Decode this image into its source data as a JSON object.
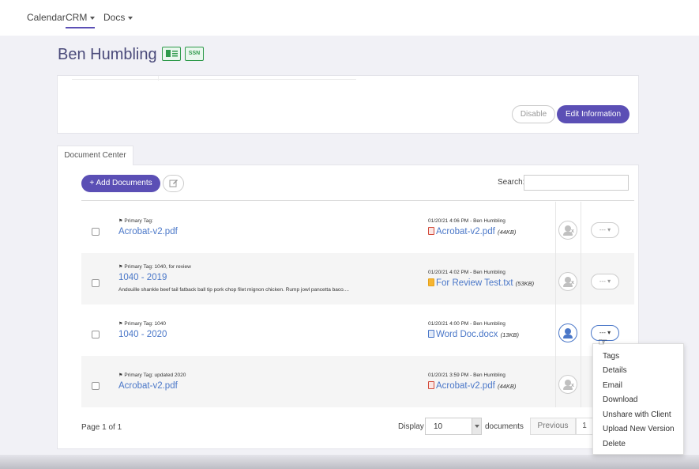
{
  "topnav": {
    "items": [
      {
        "label": "Calendar",
        "has_caret": false,
        "active": false
      },
      {
        "label": "CRM",
        "has_caret": true,
        "active": true
      },
      {
        "label": "Docs",
        "has_caret": true,
        "active": false
      }
    ]
  },
  "client": {
    "name": "Ben Humbling",
    "badges": [
      {
        "icon": "id-card-icon",
        "label": ""
      },
      {
        "icon": "ssn-card-icon",
        "label": "SSN"
      }
    ]
  },
  "info_panel": {
    "disable_label": "Disable",
    "edit_label": "Edit Information"
  },
  "document_center": {
    "tab_label": "Document Center",
    "add_label": "+ Add Documents",
    "edit_icon": "pencil-square-icon",
    "search_label": "Search:",
    "search_value": "",
    "rows": [
      {
        "tag": "Primary Tag:",
        "title": "Acrobat-v2.pdf",
        "description": "",
        "meta": "01/20/21 4:06 PM - Ben Humbling",
        "file_icon": "pdf-file-icon",
        "file_name": "Acrobat-v2.pdf",
        "file_size": "(44KB)",
        "shared": false,
        "actions_label": "--- ▾"
      },
      {
        "tag": "Primary Tag: 1040, for review",
        "title": "1040 - 2019",
        "description": "Andouille shankle beef tail fatback ball tip pork chop filet mignon chicken. Rump jowl pancetta baco....",
        "meta": "01/20/21 4:02 PM - Ben Humbling",
        "file_icon": "text-file-icon",
        "file_name": "For Review Test.txt",
        "file_size": "(53KB)",
        "shared": false,
        "actions_label": "--- ▾"
      },
      {
        "tag": "Primary Tag: 1040",
        "title": "1040 - 2020",
        "description": "",
        "meta": "01/20/21 4:00 PM - Ben Humbling",
        "file_icon": "word-file-icon",
        "file_name": "Word Doc.docx",
        "file_size": "(13KB)",
        "shared": true,
        "actions_label": "--- ▾"
      },
      {
        "tag": "Primary Tag: updated 2020",
        "title": "Acrobat-v2.pdf",
        "description": "",
        "meta": "01/20/21 3:59 PM - Ben Humbling",
        "file_icon": "pdf-file-icon",
        "file_name": "Acrobat-v2.pdf",
        "file_size": "(44KB)",
        "shared": false,
        "actions_label": "--- ▾"
      }
    ],
    "menu": [
      "Tags",
      "Details",
      "Email",
      "Download",
      "Unshare with Client",
      "Upload New Version",
      "Delete"
    ],
    "footer": {
      "page_info": "Page 1 of 1",
      "display_label": "Display",
      "display_value": "10",
      "documents_label": "documents",
      "previous_label": "Previous",
      "page_number": "1"
    }
  },
  "colors": {
    "accent": "#5b4fb5",
    "link": "#4a77c8",
    "badge_green": "#2e9a4a"
  }
}
